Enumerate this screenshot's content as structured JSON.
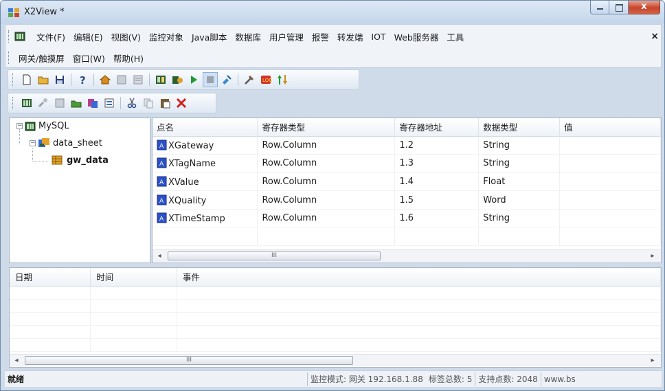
{
  "window": {
    "title": "X2View *"
  },
  "menu": {
    "row1": [
      "文件(F)",
      "编辑(E)",
      "视图(V)",
      "监控对象",
      "Java脚本",
      "数据库",
      "用户管理",
      "报警",
      "转发端",
      "IOT",
      "Web服务器",
      "工具"
    ],
    "row2": [
      "网关/触摸屏",
      "窗口(W)",
      "帮助(H)"
    ],
    "mdi_close": "×"
  },
  "toolbar1": [
    "new-file",
    "open-folder",
    "save",
    "help",
    "home",
    "page-a",
    "page-b",
    "tag-table",
    "run-device",
    "play",
    "stop",
    "connect",
    "tools",
    "lamp",
    "updown"
  ],
  "toolbar2": [
    "db-table",
    "db-link",
    "db-grid",
    "db-open",
    "db-import",
    "db-props",
    "cut",
    "copy",
    "paste",
    "delete"
  ],
  "tree": {
    "root": "MySQL",
    "child": "data_sheet",
    "leaf": "gw_data",
    "expand_glyph": "−"
  },
  "grid": {
    "columns": [
      "点名",
      "寄存器类型",
      "寄存器地址",
      "数据类型",
      "值"
    ],
    "rows": [
      [
        "XGateway",
        "Row.Column",
        "1.2",
        "String",
        ""
      ],
      [
        "XTagName",
        "Row.Column",
        "1.3",
        "String",
        ""
      ],
      [
        "XValue",
        "Row.Column",
        "1.4",
        "Float",
        ""
      ],
      [
        "XQuality",
        "Row.Column",
        "1.5",
        "Word",
        ""
      ],
      [
        "XTimeStamp",
        "Row.Column",
        "1.6",
        "String",
        ""
      ]
    ],
    "scroll_grip": "III"
  },
  "log": {
    "columns": [
      "日期",
      "时间",
      "事件"
    ],
    "scroll_grip": "III"
  },
  "status": {
    "ready": "就绪",
    "mode": "监控模式: 网关 192.168.1.88",
    "tag_total": "标签总数: 5",
    "points": "支持点数: 2048",
    "website": "www.bs"
  },
  "colors": {
    "titlebar": "#c4d5ea",
    "close_button": "#c8442a",
    "pane_border": "#a8b6c6"
  }
}
